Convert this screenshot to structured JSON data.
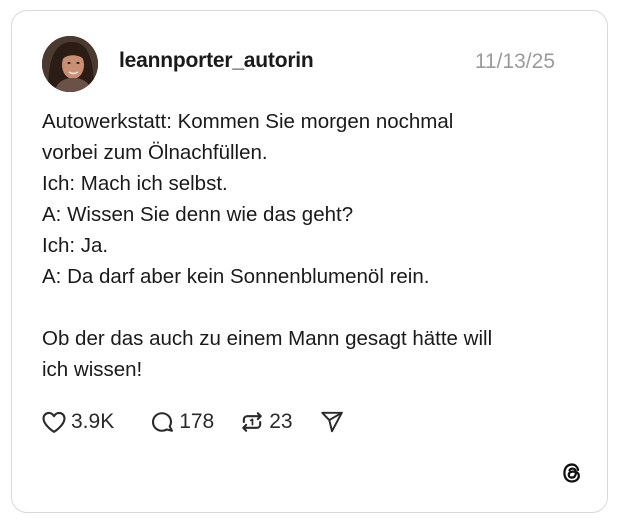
{
  "post": {
    "username": "leannporter_autorin",
    "date": "11/13/25",
    "lines": [
      "Autowerkstatt: Kommen Sie morgen nochmal",
      "vorbei zum Ölnachfüllen.",
      "Ich: Mach ich selbst.",
      "A: Wissen Sie denn wie das geht?",
      "Ich: Ja.",
      "A: Da darf aber kein Sonnenblumenöl rein.",
      "",
      "Ob der das auch zu einem Mann gesagt hätte will",
      "ich wissen!"
    ]
  },
  "actions": {
    "likes": "3.9K",
    "replies": "178",
    "reposts": "23"
  },
  "icons": {
    "like": "heart-icon",
    "reply": "comment-bubble-icon",
    "repost": "repost-icon",
    "share": "send-icon",
    "brand": "threads-logo-icon"
  }
}
